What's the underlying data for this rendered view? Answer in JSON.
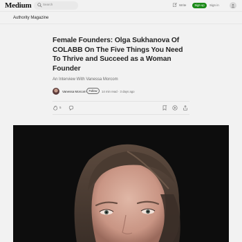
{
  "topbar": {
    "logo": "Medium",
    "search_placeholder": "Search",
    "write_label": "Write",
    "signup_label": "Sign up",
    "signin_label": "Sign in"
  },
  "publication": {
    "name": "Authority Magazine"
  },
  "article": {
    "title": "Female Founders: Olga Sukhanova Of COLABB On The Five Things You Need To Thrive and Succeed as a Woman Founder",
    "subtitle": "An Interview With Vanessa Morcom",
    "author": "Vanessa Morcom",
    "follow_label": "Follow",
    "read_time": "14 min read",
    "published": "3 days ago",
    "clap_count": "5"
  },
  "colors": {
    "accent": "#1a8917",
    "background": "#f2f2f2",
    "text": "#242424",
    "muted": "#6b6b6b"
  }
}
